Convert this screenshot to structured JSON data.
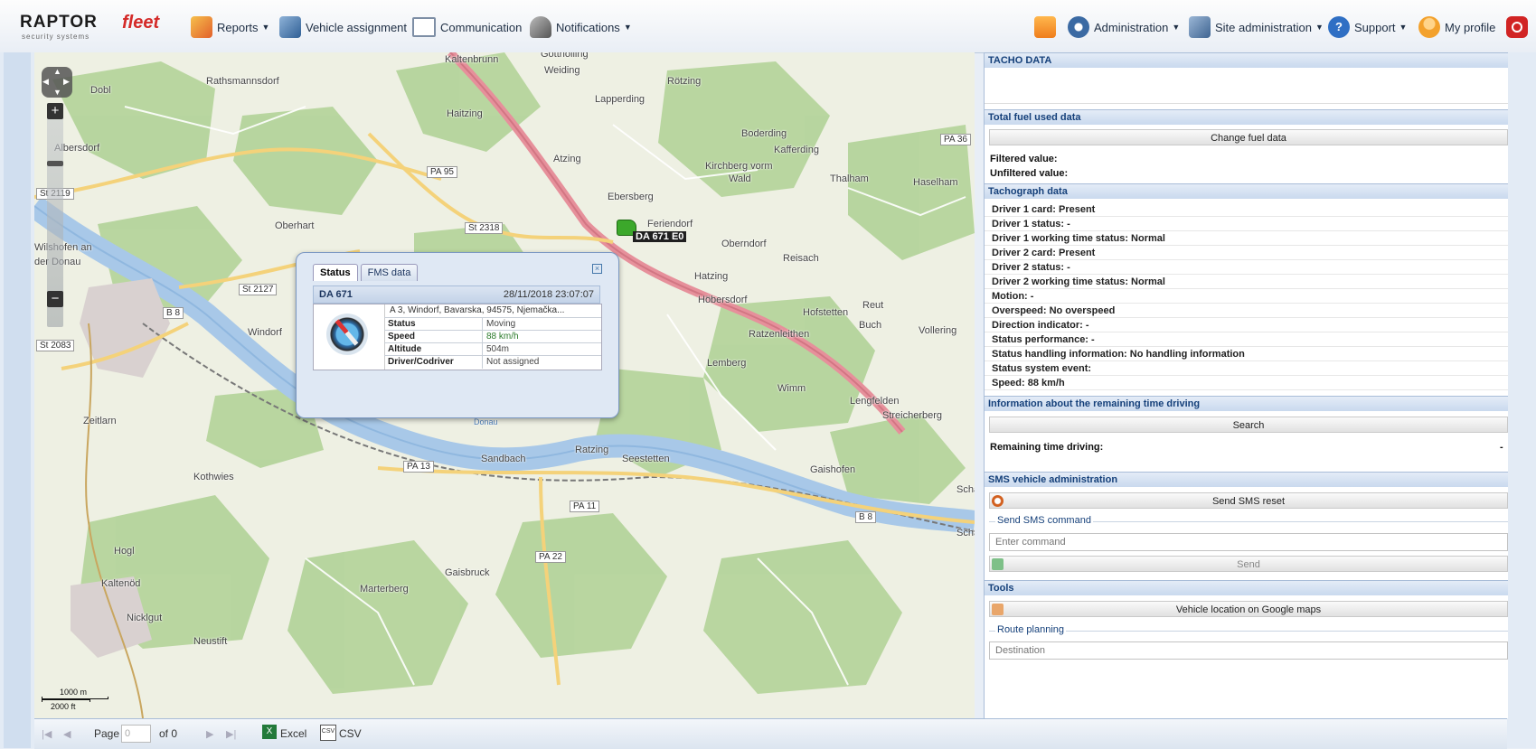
{
  "app": {
    "logo_brand": "RAPTOR",
    "logo_fleet": "fleet",
    "logo_sub": "security systems"
  },
  "topnav": {
    "reports": "Reports",
    "vehicle_assignment": "Vehicle assignment",
    "communication": "Communication",
    "notifications": "Notifications",
    "administration": "Administration",
    "site_administration": "Site administration",
    "support": "Support",
    "my_profile": "My profile",
    "caret": "▼"
  },
  "map": {
    "labels": [
      "Kaltenbrunn",
      "Gottholling",
      "Weiding",
      "Dobl",
      "Rathsmannsdorf",
      "Rötzing",
      "Lapperding",
      "Haitzing",
      "Albersdorf",
      "Boderding",
      "Kafferding",
      "Atzing",
      "Kirchberg vorm",
      "Wald",
      "Haselham",
      "Ebersberg",
      "Thalham",
      "Oberhart",
      "Feriendorf",
      "Wilshofen an",
      "der Donau",
      "Oberndorf",
      "Reisach",
      "Hatzing",
      "Reut",
      "Höbersdorf",
      "Hofstetten",
      "Buch",
      "Windorf",
      "Ratzenleithen",
      "Vollering",
      "Lemberg",
      "Wimm",
      "Zeitlarn",
      "Lengfelden",
      "Streicherberg",
      "Sandbach",
      "Ratzing",
      "Seestetten",
      "Gaishofen",
      "Kothwies",
      "Hogl",
      "Kaltenöd",
      "Gaisbruck",
      "Marterberg",
      "Nicklgut",
      "Neustift",
      "Donau",
      "Schä",
      "Scha"
    ],
    "road_shields": [
      "PA 95",
      "St 2119",
      "St 2318",
      "PA 36",
      "St 2127",
      "B 8",
      "St 2083",
      "PA 13",
      "PA 11",
      "PA 22",
      "B 8"
    ],
    "scale_metric": "1000 m",
    "scale_imperial": "2000 ft",
    "vehicle_label": "DA 671 E0",
    "zoom_in": "+",
    "zoom_out": "−"
  },
  "popup": {
    "tabs": [
      "Status",
      "FMS data"
    ],
    "close": "×",
    "vehicle": "DA 671",
    "timestamp": "28/11/2018 23:07:07",
    "address": "A 3, Windorf, Bavarska, 94575, Njemačka...",
    "rows": [
      {
        "key": "Status",
        "value": "Moving"
      },
      {
        "key": "Speed",
        "value": "88 km/h"
      },
      {
        "key": "Altitude",
        "value": "504m"
      },
      {
        "key": "Driver/Codriver",
        "value": "Not assigned"
      }
    ]
  },
  "panel": {
    "tacho_title": "TACHO DATA",
    "fuel_title": "Total fuel used data",
    "change_fuel_btn": "Change fuel data",
    "filtered_value": "Filtered value:",
    "unfiltered_value": "Unfiltered value:",
    "tachograph_title": "Tachograph data",
    "tachograph_lines": [
      "Driver 1 card: Present",
      "Driver 1 status: -",
      "Driver 1 working time status: Normal",
      "Driver 2 card: Present",
      "Driver 2 status: -",
      "Driver 2 working time status: Normal",
      "Motion: -",
      "Overspeed: No overspeed",
      "Direction indicator: -",
      "Status performance: -",
      "Status handling information: No handling information",
      "Status system event:",
      "Speed: 88 km/h"
    ],
    "remaining_title": "Information about the remaining time driving",
    "search_btn": "Search",
    "remaining_label": "Remaining time driving:",
    "remaining_value": "-",
    "sms_title": "SMS vehicle administration",
    "sms_reset_btn": "Send SMS reset",
    "sms_command_legend": "Send SMS command",
    "sms_command_placeholder": "Enter command",
    "send_btn": "Send",
    "tools_title": "Tools",
    "google_maps_btn": "Vehicle location on Google maps",
    "route_planning_legend": "Route planning",
    "destination_placeholder": "Destination"
  },
  "bottom": {
    "page_label": "Page",
    "page_value": "0",
    "of_label": "of 0",
    "excel": "Excel",
    "csv": "CSV",
    "excel_icon": "X",
    "csv_icon": "CSV"
  }
}
